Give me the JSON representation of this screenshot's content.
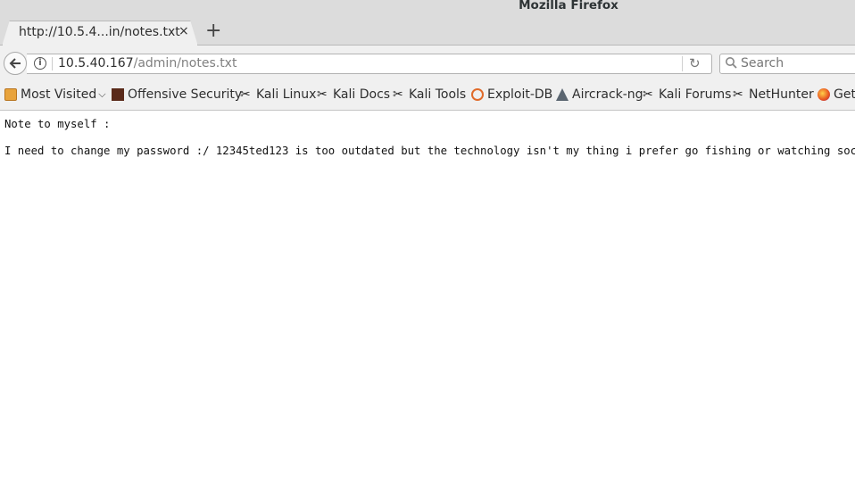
{
  "window": {
    "title": "Mozilla Firefox"
  },
  "tab": {
    "label": "http://10.5.4...in/notes.txt",
    "close_glyph": "×"
  },
  "newtab": {
    "glyph": "+"
  },
  "urlbar": {
    "host": "10.5.40.167",
    "path": "/admin/notes.txt"
  },
  "search": {
    "placeholder": "Search"
  },
  "bookmarks": [
    {
      "label": "Most Visited",
      "icon": "folder-icon"
    },
    {
      "label": "Offensive Security",
      "icon": "offsec-icon"
    },
    {
      "label": "Kali Linux",
      "icon": "kali-icon"
    },
    {
      "label": "Kali Docs",
      "icon": "kali-icon"
    },
    {
      "label": "Kali Tools",
      "icon": "kali-icon"
    },
    {
      "label": "Exploit-DB",
      "icon": "exploitdb-icon"
    },
    {
      "label": "Aircrack-ng",
      "icon": "aircrack-icon"
    },
    {
      "label": "Kali Forums",
      "icon": "kali-icon"
    },
    {
      "label": "NetHunter",
      "icon": "kali-icon"
    },
    {
      "label": "Get",
      "icon": "firefox-icon"
    }
  ],
  "content": {
    "line1": "Note to myself :",
    "line2": "I need to change my password :/ 12345ted123 is too outdated but the technology isn't my thing i prefer go fishing or watching soccer ."
  }
}
